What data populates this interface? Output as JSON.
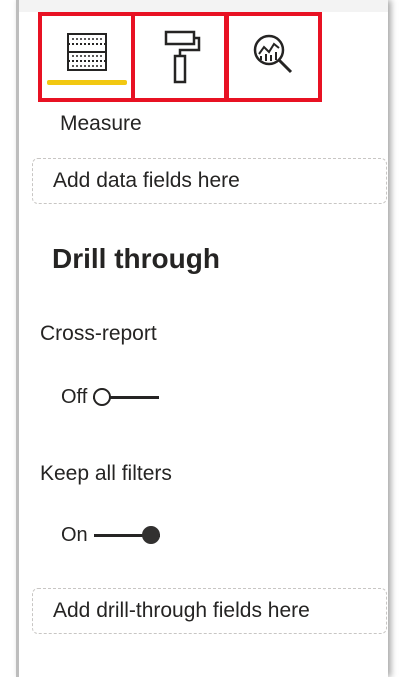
{
  "tabs": [
    {
      "id": "fields",
      "icon": "fields-well-icon",
      "selected": true
    },
    {
      "id": "format",
      "icon": "paint-roller-icon",
      "selected": false
    },
    {
      "id": "analytics",
      "icon": "analytics-magnifier-icon",
      "selected": false
    }
  ],
  "colors": {
    "highlight_border": "#e81123",
    "selected_underline": "#f2c811",
    "text": "#252423"
  },
  "values_well": {
    "label": "Measure",
    "placeholder": "Add data fields here"
  },
  "drill_through": {
    "title": "Drill through",
    "cross_report": {
      "label": "Cross-report",
      "state": "Off",
      "enabled": false
    },
    "keep_all_filters": {
      "label": "Keep all filters",
      "state": "On",
      "enabled": true
    },
    "placeholder": "Add drill-through fields here"
  }
}
